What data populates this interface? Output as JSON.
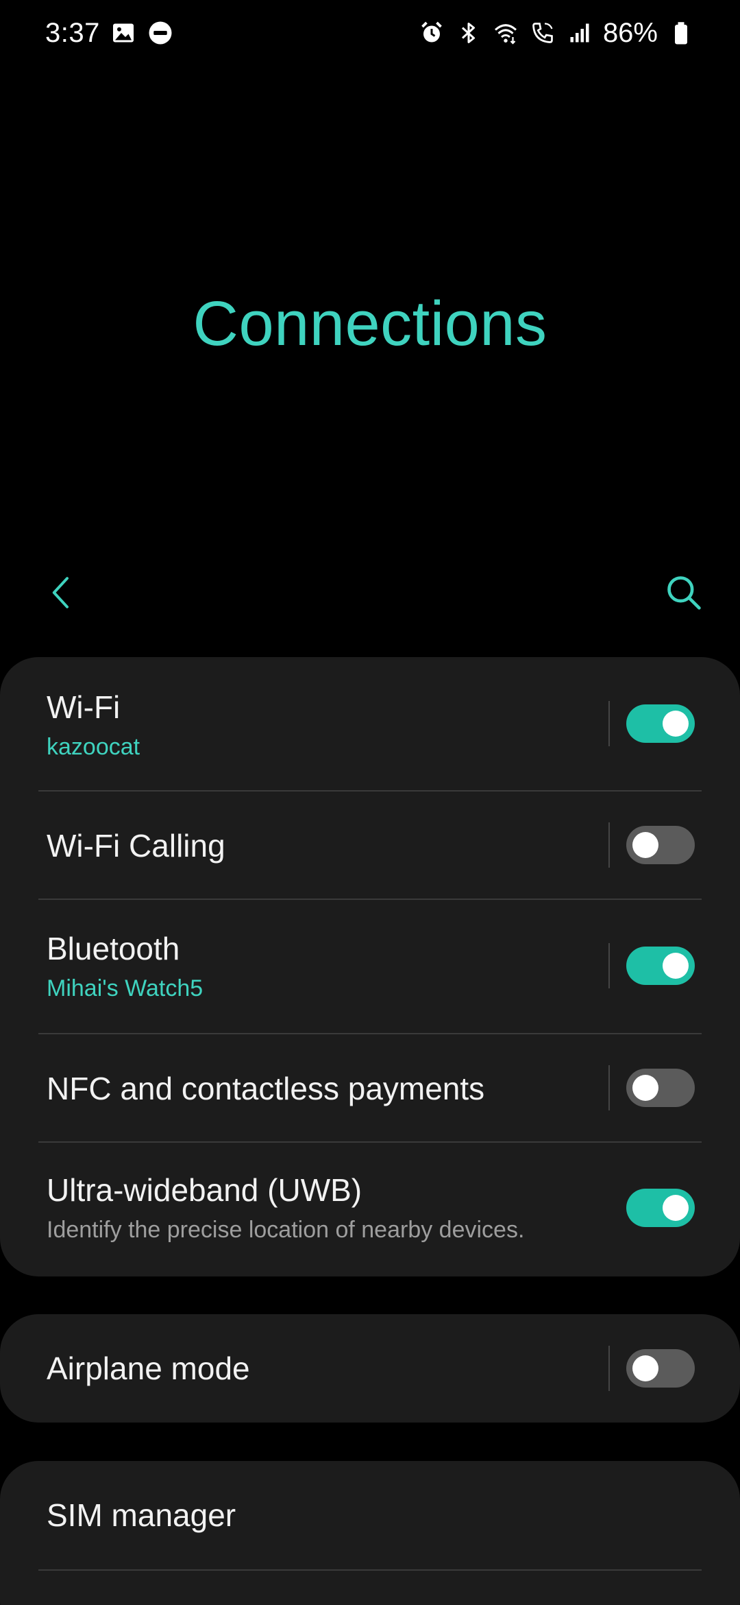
{
  "status_bar": {
    "time": "3:37",
    "battery": "86%",
    "left_icons": [
      "gallery-icon",
      "do-not-disturb-icon"
    ],
    "right_icons": [
      "alarm-icon",
      "bluetooth-icon",
      "wifi-icon",
      "wifi-calling-icon",
      "signal-icon",
      "battery-icon"
    ]
  },
  "header": {
    "title": "Connections"
  },
  "toolbar": {
    "back_icon": "chevron-left-icon",
    "search_icon": "search-icon"
  },
  "colors": {
    "accent": "#3fd3bf",
    "toggle_on": "#1ebfa6",
    "toggle_off": "#5b5b5b",
    "card_bg": "#1c1c1c",
    "background": "#000000"
  },
  "settings": {
    "wifi": {
      "title": "Wi-Fi",
      "subtitle": "kazoocat",
      "enabled": true
    },
    "wifi_calling": {
      "title": "Wi-Fi Calling",
      "enabled": false
    },
    "bluetooth": {
      "title": "Bluetooth",
      "subtitle": "Mihai's Watch5",
      "enabled": true
    },
    "nfc": {
      "title": "NFC and contactless payments",
      "enabled": false
    },
    "uwb": {
      "title": "Ultra-wideband (UWB)",
      "subtitle": "Identify the precise location of nearby devices.",
      "enabled": true
    },
    "airplane": {
      "title": "Airplane mode",
      "enabled": false
    },
    "sim_manager": {
      "title": "SIM manager"
    }
  }
}
